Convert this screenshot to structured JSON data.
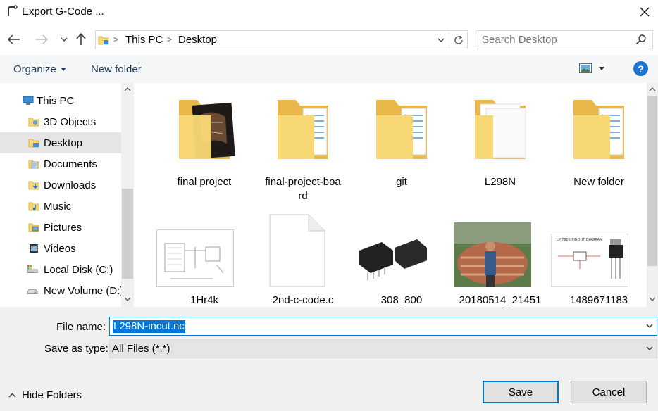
{
  "window": {
    "title": "Export G-Code ..."
  },
  "address": {
    "crumbs": [
      "This PC",
      "Desktop"
    ]
  },
  "search": {
    "placeholder": "Search Desktop"
  },
  "toolbar": {
    "organize_label": "Organize",
    "new_folder_label": "New folder"
  },
  "help": {
    "label": "?"
  },
  "nav": {
    "items": [
      {
        "label": "This PC",
        "icon": "pc-icon"
      },
      {
        "label": "3D Objects",
        "icon": "3d-objects-icon"
      },
      {
        "label": "Desktop",
        "icon": "desktop-icon",
        "selected": true
      },
      {
        "label": "Documents",
        "icon": "documents-icon"
      },
      {
        "label": "Downloads",
        "icon": "downloads-icon"
      },
      {
        "label": "Music",
        "icon": "music-icon"
      },
      {
        "label": "Pictures",
        "icon": "pictures-icon"
      },
      {
        "label": "Videos",
        "icon": "videos-icon"
      },
      {
        "label": "Local Disk (C:)",
        "icon": "local-disk-icon"
      },
      {
        "label": "New Volume (D:)",
        "icon": "drive-icon"
      }
    ]
  },
  "files": [
    {
      "name": "final project",
      "kind": "folder-with-photo"
    },
    {
      "name": "final-project-boa",
      "name2": "rd",
      "kind": "folder"
    },
    {
      "name": "git",
      "kind": "folder"
    },
    {
      "name": "L298N",
      "kind": "folder-with-papers"
    },
    {
      "name": "New folder",
      "kind": "folder"
    },
    {
      "name": "1Hr4k",
      "kind": "image-schematic"
    },
    {
      "name": "2nd-c-code.c",
      "kind": "blank-file"
    },
    {
      "name": "308_800",
      "kind": "image-components"
    },
    {
      "name": "20180514_21451",
      "kind": "image-photo"
    },
    {
      "name": "1489671183",
      "kind": "image-pinout"
    }
  ],
  "pinout_caption": "LM7805 PINOUT DIAGRAM",
  "form": {
    "file_name_label": "File name:",
    "file_name_value": "L298N-incut.nc",
    "save_type_label": "Save as type:",
    "save_type_value": "All Files (*.*)"
  },
  "footer": {
    "hide_folders_label": "Hide Folders",
    "save_label": "Save",
    "cancel_label": "Cancel"
  },
  "colors": {
    "accent": "#0078d7",
    "folder": "#f8d775",
    "selected_nav": "#e5e5e5",
    "bottom_panel": "#f0f0f0"
  }
}
